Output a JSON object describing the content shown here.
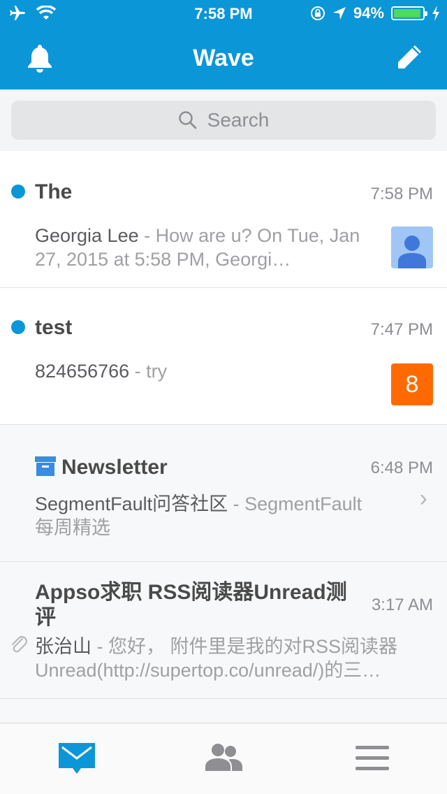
{
  "status_bar": {
    "time": "7:58 PM",
    "battery": "94%",
    "battery_level": 0.94
  },
  "nav": {
    "title": "Wave",
    "left_icon": "bell-icon",
    "right_icon": "compose-icon"
  },
  "search": {
    "placeholder": "Search"
  },
  "messages": [
    {
      "subject": "The",
      "time": "7:58 PM",
      "sender": "Georgia Lee",
      "separator": " - ",
      "snippet": "How are u? On Tue, Jan 27, 2015 at 5:58 PM, Georgi…",
      "unread": true,
      "avatar": "person"
    },
    {
      "subject": "test",
      "time": "7:47 PM",
      "sender": "824656766",
      "separator": " - ",
      "snippet": "try",
      "unread": true,
      "badge": "8"
    },
    {
      "subject": "Newsletter",
      "time": "6:48 PM",
      "sender": "SegmentFault问答社区",
      "separator": " - ",
      "snippet": "SegmentFault每周精选",
      "icon": "archive-icon"
    },
    {
      "subject": "Appso求职 RSS阅读器Unread测评",
      "time": "3:17 AM",
      "sender": "张治山",
      "separator": " - ",
      "snippet": "您好， 附件里是我的对RSS阅读器Unread(http://supertop.co/unread/)的三…",
      "attachment": true
    }
  ],
  "tabs": [
    {
      "name": "mail",
      "icon": "mail-icon",
      "active": true
    },
    {
      "name": "contacts",
      "icon": "contacts-icon",
      "active": false
    },
    {
      "name": "menu",
      "icon": "menu-icon",
      "active": false
    }
  ],
  "colors": {
    "brand": "#0b96d8",
    "badge": "#ff6a00",
    "battery": "#4cd964"
  }
}
